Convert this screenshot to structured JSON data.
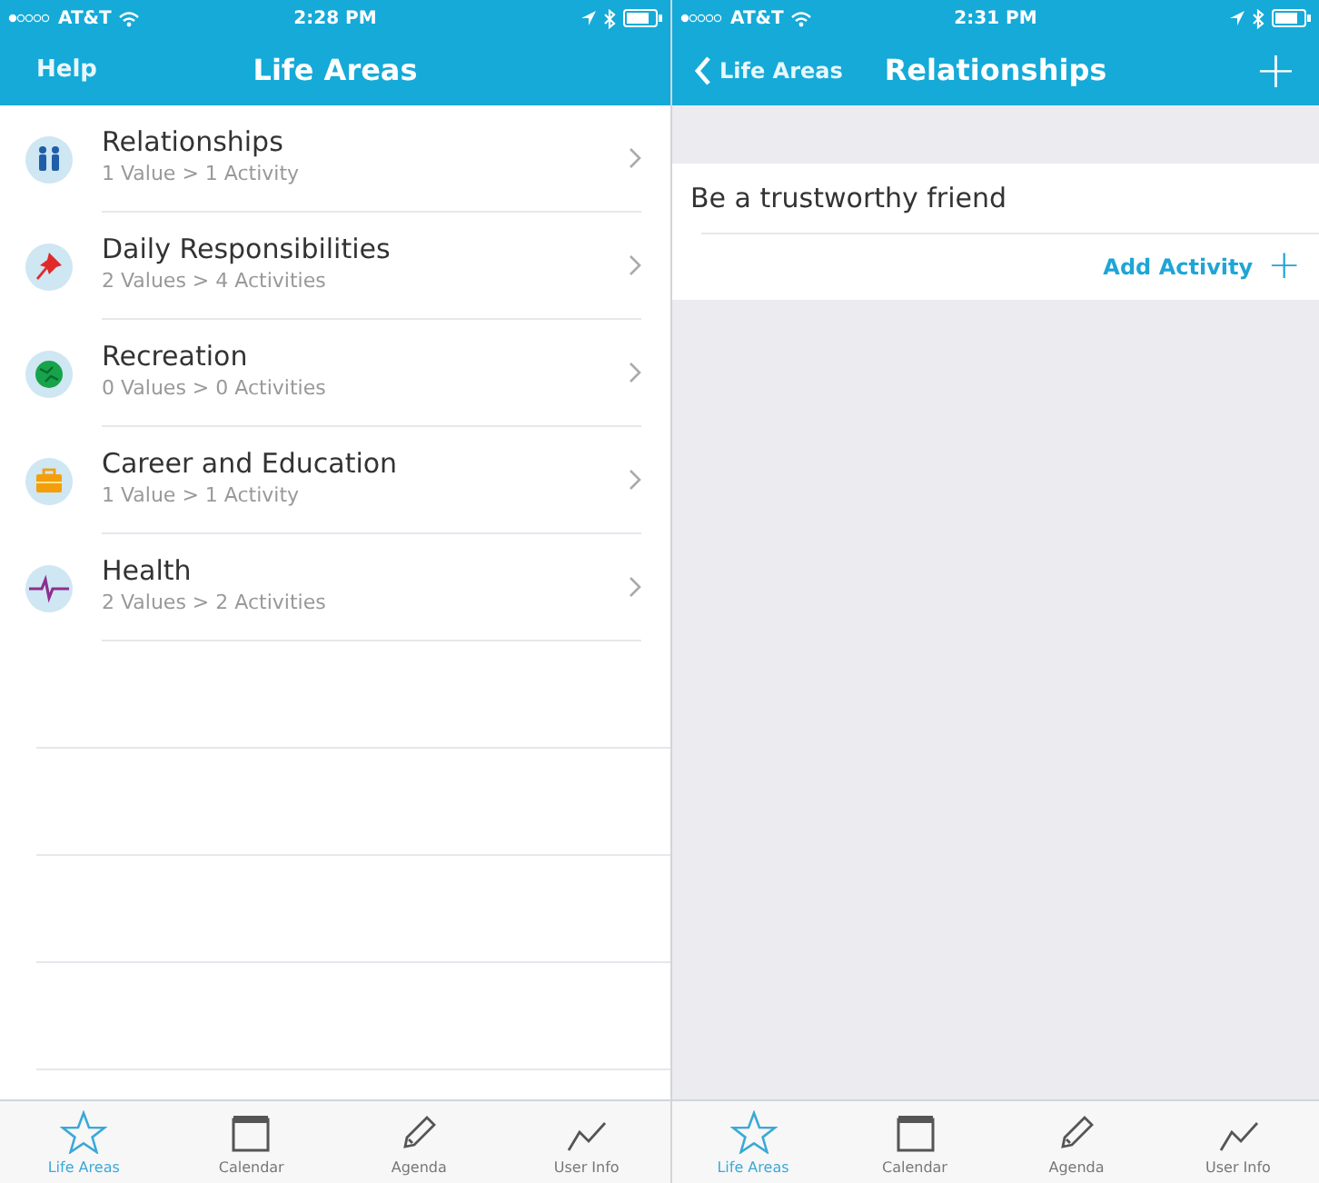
{
  "screens": [
    {
      "status_bar": {
        "carrier": "AT&T",
        "time": "2:28 PM"
      },
      "nav": {
        "left": {
          "kind": "text",
          "label": "Help"
        },
        "title": "Life Areas"
      },
      "kind": "list",
      "life_areas": [
        {
          "kind": "people",
          "title": "Relationships",
          "subtitle": "1 Value > 1 Activity"
        },
        {
          "kind": "pin",
          "title": "Daily Responsibilities",
          "subtitle": "2 Values > 4 Activities"
        },
        {
          "kind": "globe",
          "title": "Recreation",
          "subtitle": "0 Values > 0 Activities"
        },
        {
          "kind": "briefcase",
          "title": "Career and Education",
          "subtitle": "1 Value > 1 Activity"
        },
        {
          "kind": "pulse",
          "title": "Health",
          "subtitle": "2 Values > 2 Activities"
        }
      ],
      "tabs": [
        {
          "kind": "star",
          "label": "Life Areas",
          "selected": true
        },
        {
          "kind": "calendar",
          "label": "Calendar",
          "selected": false
        },
        {
          "kind": "pencil",
          "label": "Agenda",
          "selected": false
        },
        {
          "kind": "chart",
          "label": "User Info",
          "selected": false
        }
      ]
    },
    {
      "status_bar": {
        "carrier": "AT&T",
        "time": "2:31 PM"
      },
      "nav": {
        "left": {
          "kind": "back",
          "label": "Life Areas"
        },
        "title": "Relationships",
        "right": "+"
      },
      "kind": "detail",
      "values": [
        {
          "title": "Be a trustworthy friend",
          "action": "Add Activity",
          "action_icon": "+"
        }
      ],
      "tabs": [
        {
          "kind": "star",
          "label": "Life Areas",
          "selected": true
        },
        {
          "kind": "calendar",
          "label": "Calendar",
          "selected": false
        },
        {
          "kind": "pencil",
          "label": "Agenda",
          "selected": false
        },
        {
          "kind": "chart",
          "label": "User Info",
          "selected": false
        }
      ]
    }
  ]
}
